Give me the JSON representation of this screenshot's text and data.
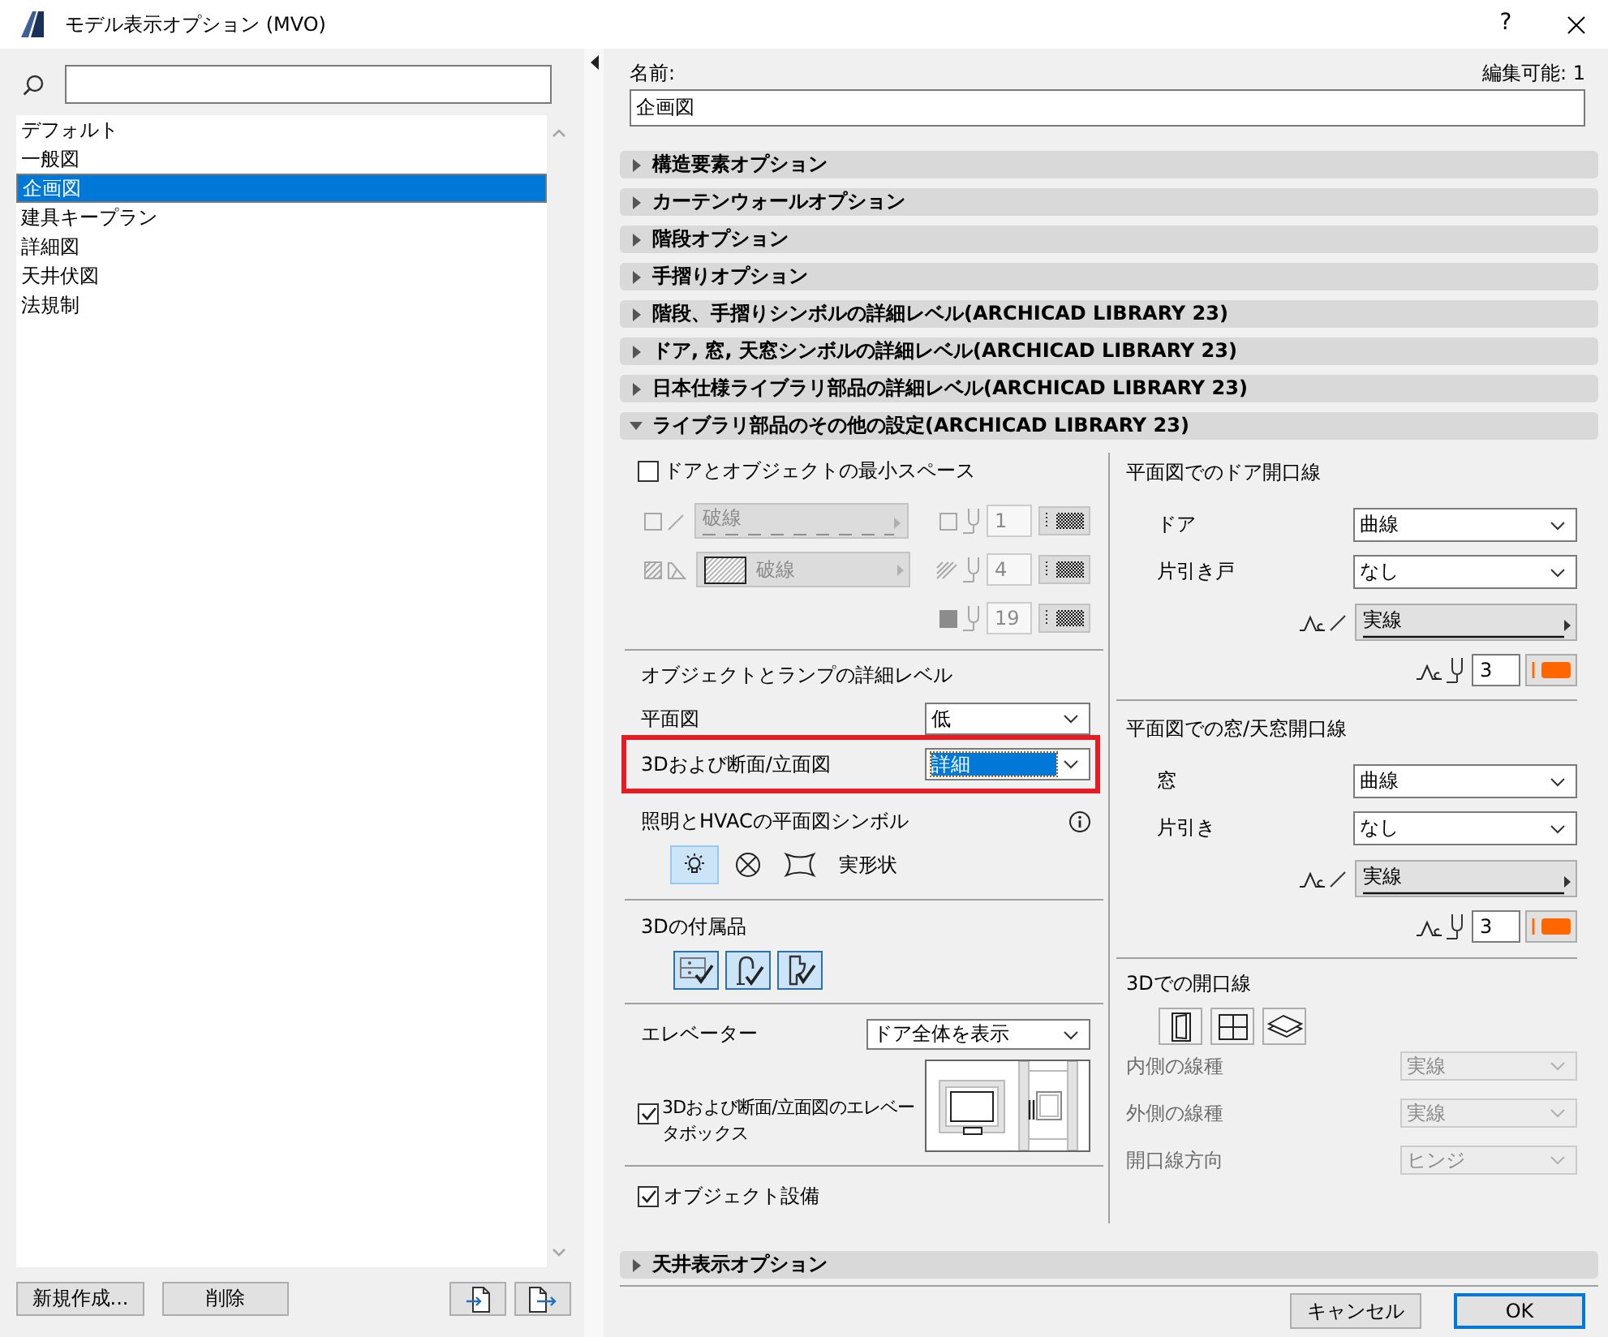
{
  "window": {
    "title": "モデル表示オプション (MVO)",
    "help": "?"
  },
  "sidebar": {
    "items": [
      {
        "label": "デフォルト",
        "selected": false
      },
      {
        "label": "一般図",
        "selected": false
      },
      {
        "label": "企画図",
        "selected": true
      },
      {
        "label": "建具キープラン",
        "selected": false
      },
      {
        "label": "詳細図",
        "selected": false
      },
      {
        "label": "天井伏図",
        "selected": false
      },
      {
        "label": "法規制",
        "selected": false
      }
    ],
    "buttons": [
      "新規作成...",
      "削除"
    ]
  },
  "name": {
    "label": "名前:",
    "value": "企画図",
    "edit_count": "編集可能: 1"
  },
  "sections": [
    {
      "title": "構造要素オプション",
      "expanded": false
    },
    {
      "title": "カーテンウォールオプション",
      "expanded": false
    },
    {
      "title": "階段オプション",
      "expanded": false
    },
    {
      "title": "手摺りオプション",
      "expanded": false
    },
    {
      "title": "階段、手摺りシンボルの詳細レベル(ARCHICAD LIBRARY 23)",
      "expanded": false
    },
    {
      "title": "ドア, 窓, 天窓シンボルの詳細レベル(ARCHICAD LIBRARY 23)",
      "expanded": false
    },
    {
      "title": "日本仕様ライブラリ部品の詳細レベル(ARCHICAD LIBRARY 23)",
      "expanded": false
    },
    {
      "title": "ライブラリ部品のその他の設定(ARCHICAD LIBRARY 23)",
      "expanded": true,
      "content": {
        "left": {
          "min_space": {
            "label": "ドアとオブジェクトの最小スペース",
            "checked": false
          },
          "min_space_pens": {
            "disabled": true,
            "line_type": "破線",
            "fill_type": "破線",
            "pens": [
              "1",
              "4",
              "19"
            ]
          },
          "detail_level": {
            "title": "オブジェクトとランプの詳細レベル",
            "rows": [
              {
                "label": "平面図",
                "value": "低",
                "highlighted": false,
                "text_selected": false
              },
              {
                "label": "3Dおよび断面/立面図",
                "value": "詳細",
                "highlighted": true,
                "text_selected": true
              }
            ]
          },
          "lighting": {
            "title": "照明とHVACの平面図シンボル",
            "options": [
              {
                "kind": "bulb",
                "selected": true
              },
              {
                "kind": "crossed_circle",
                "selected": false
              },
              {
                "kind": "concave",
                "selected": false
              },
              {
                "kind": "text",
                "label": "実形状",
                "selected": false
              }
            ]
          },
          "accessories": {
            "title": "3Dの付属品",
            "options": [
              {
                "kind": "drawer",
                "selected": true
              },
              {
                "kind": "faucet",
                "selected": true
              },
              {
                "kind": "toilet",
                "selected": true
              }
            ]
          },
          "elevator": {
            "label": "エレベーター",
            "value": "ドア全体を表示"
          },
          "elevator_box": {
            "label": "3Dおよび断面/立面図のエレベータボックス",
            "checked": true
          },
          "equipment": {
            "label": "オブジェクト設備",
            "checked": true
          }
        },
        "right": {
          "groups": [
            {
              "title": "平面図でのドア開口線",
              "rows": [
                {
                  "label": "ドア",
                  "value": "曲線"
                },
                {
                  "label": "片引き戸",
                  "value": "なし"
                }
              ],
              "line_type": "実線",
              "pen": "3"
            },
            {
              "title": "平面図での窓/天窓開口線",
              "rows": [
                {
                  "label": "窓",
                  "value": "曲線"
                },
                {
                  "label": "片引き",
                  "value": "なし"
                }
              ],
              "line_type": "実線",
              "pen": "3"
            }
          ],
          "lines_3d": {
            "title": "3Dでの開口線",
            "options": [
              {
                "kind": "door",
                "selected": false
              },
              {
                "kind": "window",
                "selected": false
              },
              {
                "kind": "plane",
                "selected": false
              }
            ],
            "disabled": true,
            "rows": [
              {
                "label": "内側の線種",
                "value": "実線"
              },
              {
                "label": "外側の線種",
                "value": "実線"
              },
              {
                "label": "開口線方向",
                "value": "ヒンジ"
              }
            ]
          }
        }
      }
    },
    {
      "title": "天井表示オプション",
      "expanded": false
    }
  ],
  "footer": {
    "buttons": [
      {
        "label": "キャンセル",
        "default": false
      },
      {
        "label": "OK",
        "default": true
      }
    ]
  }
}
